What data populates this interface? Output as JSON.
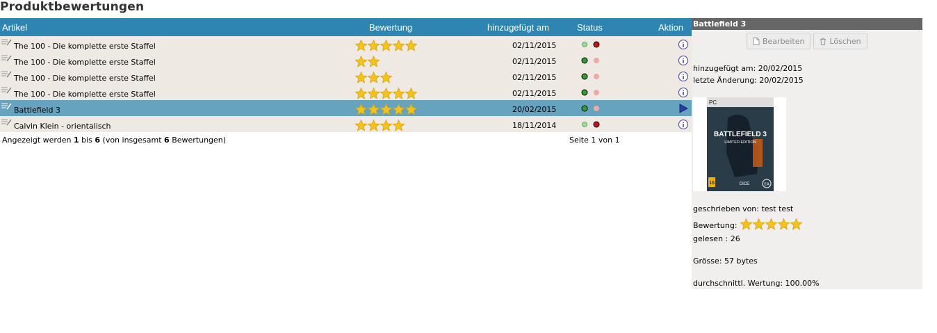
{
  "page": {
    "title": "Produktbewertungen"
  },
  "table": {
    "headers": {
      "artikel": "Artikel",
      "bewertung": "Bewertung",
      "datum": "hinzugefügt am",
      "status": "Status",
      "aktion": "Aktion"
    },
    "rows": [
      {
        "name": "The 100 - Die komplette erste Staffel",
        "stars": 5,
        "date": "02/11/2015",
        "status_active": false,
        "selected": false
      },
      {
        "name": "The 100 - Die komplette erste Staffel",
        "stars": 2,
        "date": "02/11/2015",
        "status_active": true,
        "selected": false
      },
      {
        "name": "The 100 - Die komplette erste Staffel",
        "stars": 3,
        "date": "02/11/2015",
        "status_active": true,
        "selected": false
      },
      {
        "name": "The 100 - Die komplette erste Staffel",
        "stars": 5,
        "date": "02/11/2015",
        "status_active": true,
        "selected": false
      },
      {
        "name": "Battlefield 3",
        "stars": 5,
        "date": "20/02/2015",
        "status_active": true,
        "selected": true
      },
      {
        "name": "Calvin Klein - orientalisch",
        "stars": 4,
        "date": "18/11/2014",
        "status_active": false,
        "selected": false
      }
    ],
    "footer": {
      "prefix": "Angezeigt werden ",
      "from": "1",
      "mid": " bis ",
      "to": "6",
      "mid2": " (von insgesamt ",
      "total": "6",
      "suffix": " Bewertungen)",
      "pages": "Seite 1 von 1"
    }
  },
  "panel": {
    "title": "Battlefield 3",
    "edit_label": "Bearbeiten",
    "delete_label": "Löschen",
    "added": "hinzugefügt am: 20/02/2015",
    "changed": "letzte Änderung: 20/02/2015",
    "cover_text": "BATTLEFIELD 3",
    "cover_sub": "LIMITED EDITION",
    "cover_pc": "PC",
    "cover_age": "16",
    "cover_dice": "DICE",
    "cover_ea": "EA",
    "author": "geschrieben von: test test",
    "rating_label": "Bewertung:",
    "rating_stars": 5,
    "read": "gelesen : 26",
    "size": "Grösse: 57 bytes",
    "average": "durchschnittl. Wertung: 100.00%"
  },
  "colors": {
    "header": "#2f85b1",
    "row": "#efe9e4",
    "selected": "#65a3bf",
    "star": "#f3c319",
    "green": "#2fa02f",
    "red": "#cc1111"
  }
}
